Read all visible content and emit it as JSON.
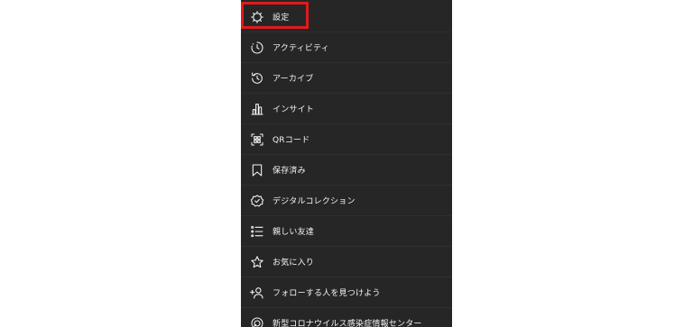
{
  "menu": {
    "items": [
      {
        "label": "設定",
        "icon": "gear-icon"
      },
      {
        "label": "アクティビティ",
        "icon": "activity-clock-icon"
      },
      {
        "label": "アーカイブ",
        "icon": "archive-history-icon"
      },
      {
        "label": "インサイト",
        "icon": "insights-bar-chart-icon"
      },
      {
        "label": "QRコード",
        "icon": "qr-code-icon"
      },
      {
        "label": "保存済み",
        "icon": "bookmark-icon"
      },
      {
        "label": "デジタルコレクション",
        "icon": "verified-shield-icon"
      },
      {
        "label": "親しい友達",
        "icon": "close-friends-list-icon"
      },
      {
        "label": "お気に入り",
        "icon": "star-icon"
      },
      {
        "label": "フォローする人を見つけよう",
        "icon": "add-person-icon"
      },
      {
        "label": "新型コロナウイルス感染症情報センター",
        "icon": "covid-info-icon"
      }
    ]
  },
  "colors": {
    "background": "#262626",
    "text": "#f5f5f5",
    "highlight": "#e01b1b"
  }
}
